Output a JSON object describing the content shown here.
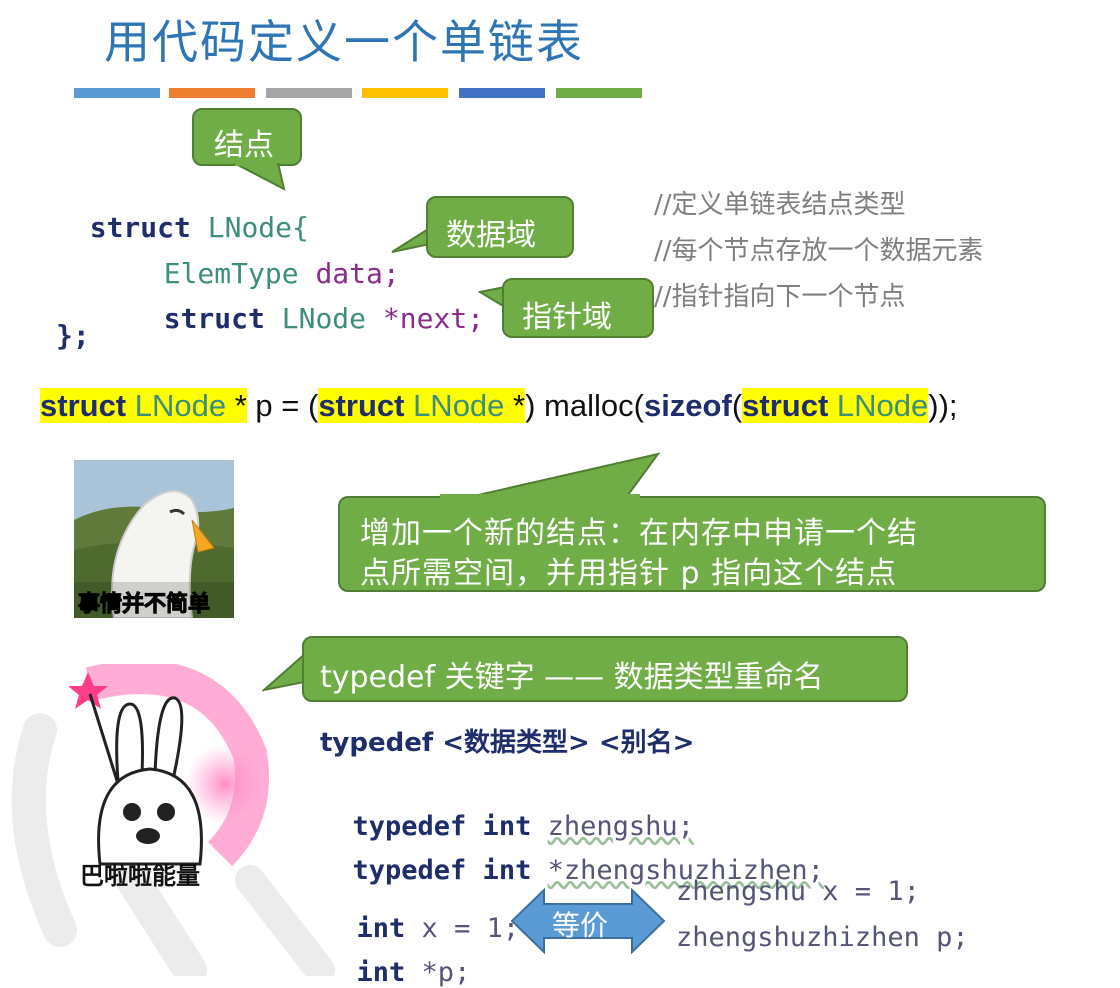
{
  "slide": {
    "title": "用代码定义一个单链表",
    "accent_colors": [
      "#5b9bd5",
      "#ed7d31",
      "#a5a5a5",
      "#ffc000",
      "#4472c4",
      "#70ad47"
    ]
  },
  "callouts": {
    "node": "结点",
    "data_field": "数据域",
    "pointer_field": "指针域",
    "new_node_line1": "增加一个新的结点：在内存中申请一个结",
    "new_node_line2": "点所需空间，并用指针 p 指向这个结点",
    "typedef_desc": "typedef 关键字 —— 数据类型重命名",
    "equivalent": "等价"
  },
  "struct_code": {
    "line1_kw": "struct",
    "line1_name": "LNode{",
    "line2_type": "ElemType",
    "line2_var": "data;",
    "line3_kw": "struct",
    "line3_type": "LNode",
    "line3_var": "*next;",
    "line4": "};",
    "comment1": "//定义单链表结点类型",
    "comment2": "//每个节点存放一个数据元素",
    "comment3": "//指针指向下一个节点"
  },
  "malloc_line": {
    "p1_kw": "struct",
    "p1_type": " LNode",
    "p1_star": " *",
    "p2": " p = (",
    "p3_kw": "struct",
    "p3_type": " LNode",
    "p3_star": " *",
    "p4": ") malloc(",
    "p5_kw": "sizeof",
    "p6": "(",
    "p7_kw": "struct",
    "p7_type": " LNode",
    "p8": "));"
  },
  "typedef_section": {
    "syntax": "typedef <数据类型> <别名>",
    "ex1_kw": "typedef int",
    "ex1_id": "zhengshu;",
    "ex2_kw": "typedef int",
    "ex2_id": "*zhengshuzhizhen;",
    "left1_kw": "int",
    "left1_rest": " x = 1;",
    "left2_kw": "int",
    "left2_rest": " *p;",
    "right1": "zhengshu x = 1;",
    "right2": "zhengshuzhizhen p;"
  },
  "stickers": {
    "goose_caption": "事情并不简单",
    "bunny_caption": "巴啦啦能量"
  }
}
